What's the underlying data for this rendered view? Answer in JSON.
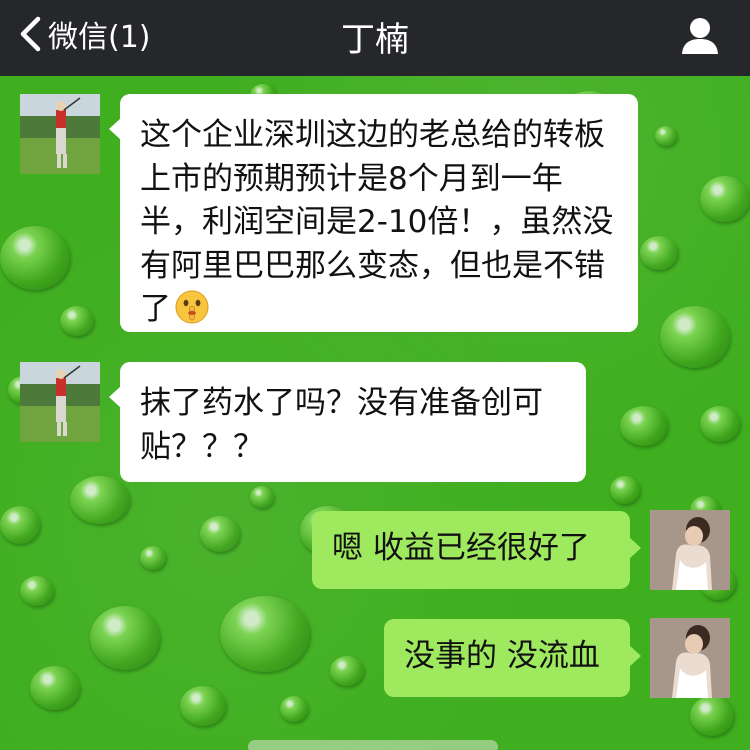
{
  "nav": {
    "back_label": "微信(1)",
    "title": "丁楠",
    "icons": {
      "back": "chevron-left-icon",
      "profile": "person-icon"
    }
  },
  "messages": [
    {
      "direction": "incoming",
      "text": "这个企业深圳这边的老总给的转板上市的预期预计是8个月到一年半，利润空间是2-10倍！，虽然没有阿里巴巴那么变态，但也是不错了",
      "emoji": "shush-face-emoji"
    },
    {
      "direction": "incoming",
      "text": "抹了药水了吗？没有准备创可贴？？？"
    },
    {
      "direction": "outgoing",
      "text": "嗯 收益已经很好了"
    },
    {
      "direction": "outgoing",
      "text": "没事的 没流血"
    }
  ],
  "colors": {
    "nav_bg": "#25272b",
    "background": "#3fae1f",
    "incoming_bubble": "#ffffff",
    "outgoing_bubble": "#9fe95e"
  }
}
